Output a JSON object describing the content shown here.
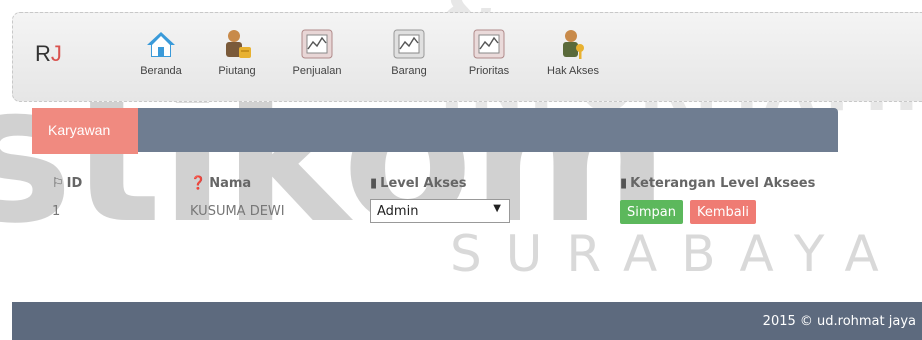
{
  "watermark": {
    "top": "& INFORMATIK",
    "middle": "stikom",
    "bottom": "SURABAYA"
  },
  "brand": {
    "prefix": "R",
    "suffix": "J"
  },
  "nav": [
    {
      "label": "Beranda",
      "icon": "home-icon"
    },
    {
      "label": "Piutang",
      "icon": "user-coins-icon"
    },
    {
      "label": "Penjualan",
      "icon": "chart-icon"
    },
    {
      "label": "Barang",
      "icon": "chart-icon"
    },
    {
      "label": "Prioritas",
      "icon": "chart-icon"
    },
    {
      "label": "Hak Akses",
      "icon": "user-key-icon"
    }
  ],
  "tab": {
    "label": "Karyawan"
  },
  "table": {
    "headers": {
      "id": "ID",
      "nama": "Nama",
      "level": "Level Akses",
      "keterangan": "Keterangan Level Aksees"
    },
    "row": {
      "id": "1",
      "nama": "KUSUMA DEWI",
      "level_selected": "Admin"
    }
  },
  "buttons": {
    "save": "Simpan",
    "back": "Kembali"
  },
  "footer": {
    "text": "2015 © ud.rohmat jaya"
  },
  "colors": {
    "accent": "#f08a80",
    "panel": "#6f7d91",
    "save": "#5cb85c",
    "back": "#ef7b73",
    "footer": "#5d6a7e"
  }
}
